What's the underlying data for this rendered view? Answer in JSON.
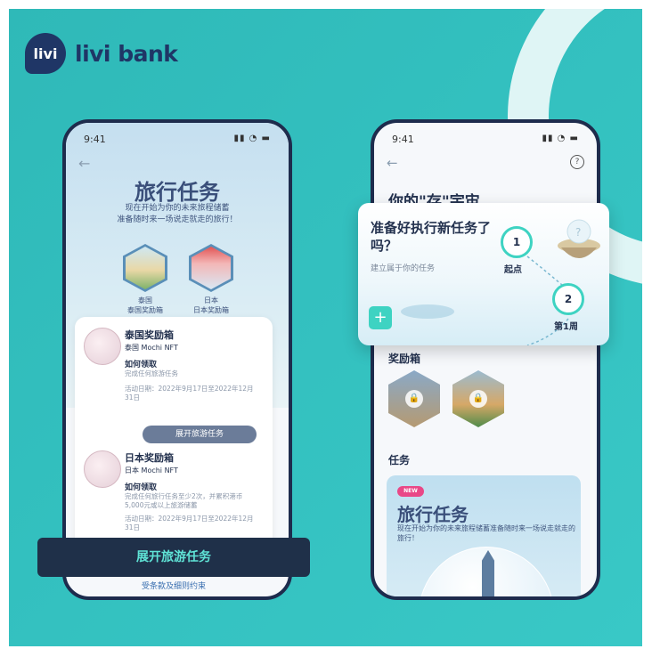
{
  "brand": {
    "name": "livi bank",
    "logo_text": "livi"
  },
  "left_phone": {
    "status_time": "9:41",
    "title": "旅行任务",
    "subtitle_line1": "现在开始为你的未来旅程储蓄",
    "subtitle_line2": "准备随时来一场说走就走的旅行！",
    "boxes": [
      {
        "country": "泰国",
        "name": "泰国奖励箱"
      },
      {
        "country": "日本",
        "name": "日本奖励箱"
      }
    ],
    "rewards": [
      {
        "title": "泰国奖励箱",
        "nft": "泰国 Mochi NFT",
        "how_label": "如何领取",
        "how_desc": "完成任何旅游任务",
        "date": "活动日期：2022年9月17日至2022年12月31日"
      },
      {
        "title": "日本奖励箱",
        "nft": "日本 Mochi NFT",
        "how_label": "如何领取",
        "how_desc": "完成任何旅行任务至少2次，并累积港币5,000元或以上旅游储蓄",
        "date": "活动日期：2022年9月17日至2022年12月31日"
      }
    ],
    "expand_pill": "展开旅游任务",
    "main_button": "展开旅游任务",
    "terms": "受条款及细则约束"
  },
  "right_phone": {
    "status_time": "9:41",
    "title": "你的\"存\"宇宙",
    "reward_section": "奖励箱",
    "task_section": "任务",
    "task_card": {
      "badge": "NEW",
      "title": "旅行任务",
      "desc": "现在开始为你的未来旅程储蓄准备随时来一场说走就走的旅行！"
    }
  },
  "popup": {
    "title": "准备好执行新任务了吗？",
    "subtitle": "建立属于你的任务",
    "plus": "+",
    "nodes": [
      {
        "num": "1",
        "label": "起点"
      },
      {
        "num": "2",
        "label": "第1周"
      }
    ]
  },
  "colors": {
    "teal_bg": "#33c0bf",
    "navy": "#1f3666",
    "accent": "#3ed3c2",
    "badge": "#e94887"
  }
}
